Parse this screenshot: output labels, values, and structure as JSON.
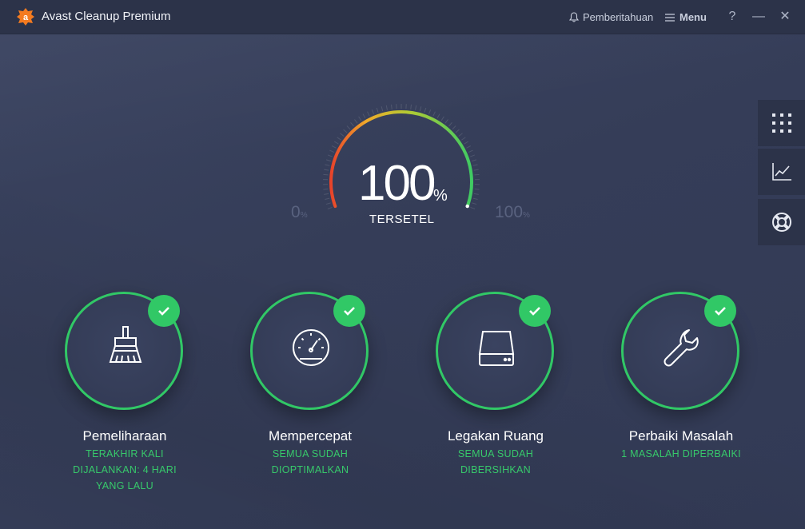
{
  "app": {
    "title": "Avast Cleanup Premium"
  },
  "header": {
    "notifications_label": "Pemberitahuan",
    "menu_label": "Menu",
    "help_label": "?",
    "minimize_label": "—",
    "close_label": "✕"
  },
  "sidebar": {
    "items": [
      {
        "icon": "grid-icon"
      },
      {
        "icon": "chart-icon"
      },
      {
        "icon": "lifebuoy-icon"
      }
    ]
  },
  "gauge": {
    "value_number": "100",
    "value_unit": "%",
    "status": "TERSETEL",
    "min_number": "0",
    "min_unit": "%",
    "max_number": "100",
    "max_unit": "%",
    "fill_percent": 100
  },
  "tiles": [
    {
      "title": "Pemeliharaan",
      "icon": "broom-icon",
      "status": "complete",
      "lines": [
        "TERAKHIR KALI",
        "DIJALANKAN: 4 HARI",
        "YANG LALU"
      ]
    },
    {
      "title": "Mempercepat",
      "icon": "speedometer-icon",
      "status": "complete",
      "lines": [
        "SEMUA SUDAH",
        "DIOPTIMALKAN"
      ]
    },
    {
      "title": "Legakan Ruang",
      "icon": "hard-drive-icon",
      "status": "complete",
      "lines": [
        "SEMUA SUDAH",
        "DIBERSIHKAN"
      ]
    },
    {
      "title": "Perbaiki Masalah",
      "icon": "wrench-icon",
      "status": "complete",
      "lines": [
        "1 MASALAH DIPERBAIKI"
      ]
    }
  ],
  "colors": {
    "accent_green": "#31c866",
    "brand_orange": "#f47b20",
    "background": "#353d58"
  }
}
